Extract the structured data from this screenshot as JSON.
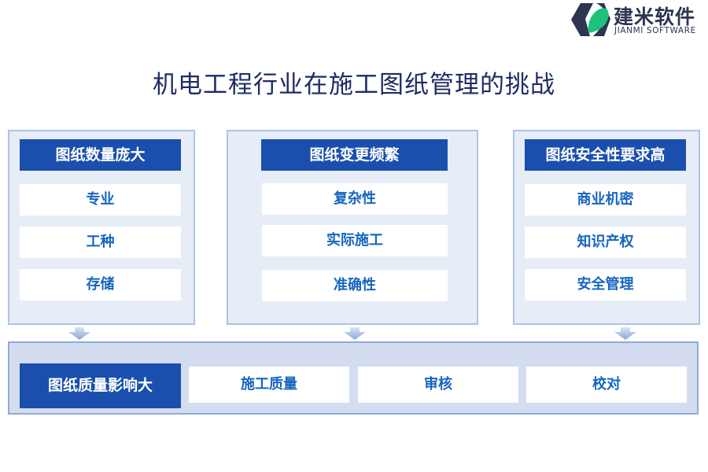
{
  "logo": {
    "name_cn": "建米软件",
    "name_en": "JIANMI SOFTWARE",
    "colors": {
      "dark": "#2e3550",
      "green": "#1fc27d"
    }
  },
  "title": "机电工程行业在施工图纸管理的挑战",
  "colors": {
    "accent": "#1b4fae",
    "item_text": "#1565c0",
    "panel_bg": "#e6edf7",
    "panel_border": "#aec2e4",
    "bottom_bg": "#d4ddf0",
    "title": "#1e2c63"
  },
  "panels": [
    {
      "heading": "图纸数量庞大",
      "items": [
        "专业",
        "工种",
        "存储"
      ]
    },
    {
      "heading": "图纸变更频繁",
      "items": [
        "复杂性",
        "实际施工",
        "准确性"
      ]
    },
    {
      "heading": "图纸安全性要求高",
      "items": [
        "商业机密",
        "知识产权",
        "安全管理"
      ]
    }
  ],
  "bottom": {
    "heading": "图纸质量影响大",
    "items": [
      "施工质量",
      "审核",
      "校对"
    ]
  }
}
